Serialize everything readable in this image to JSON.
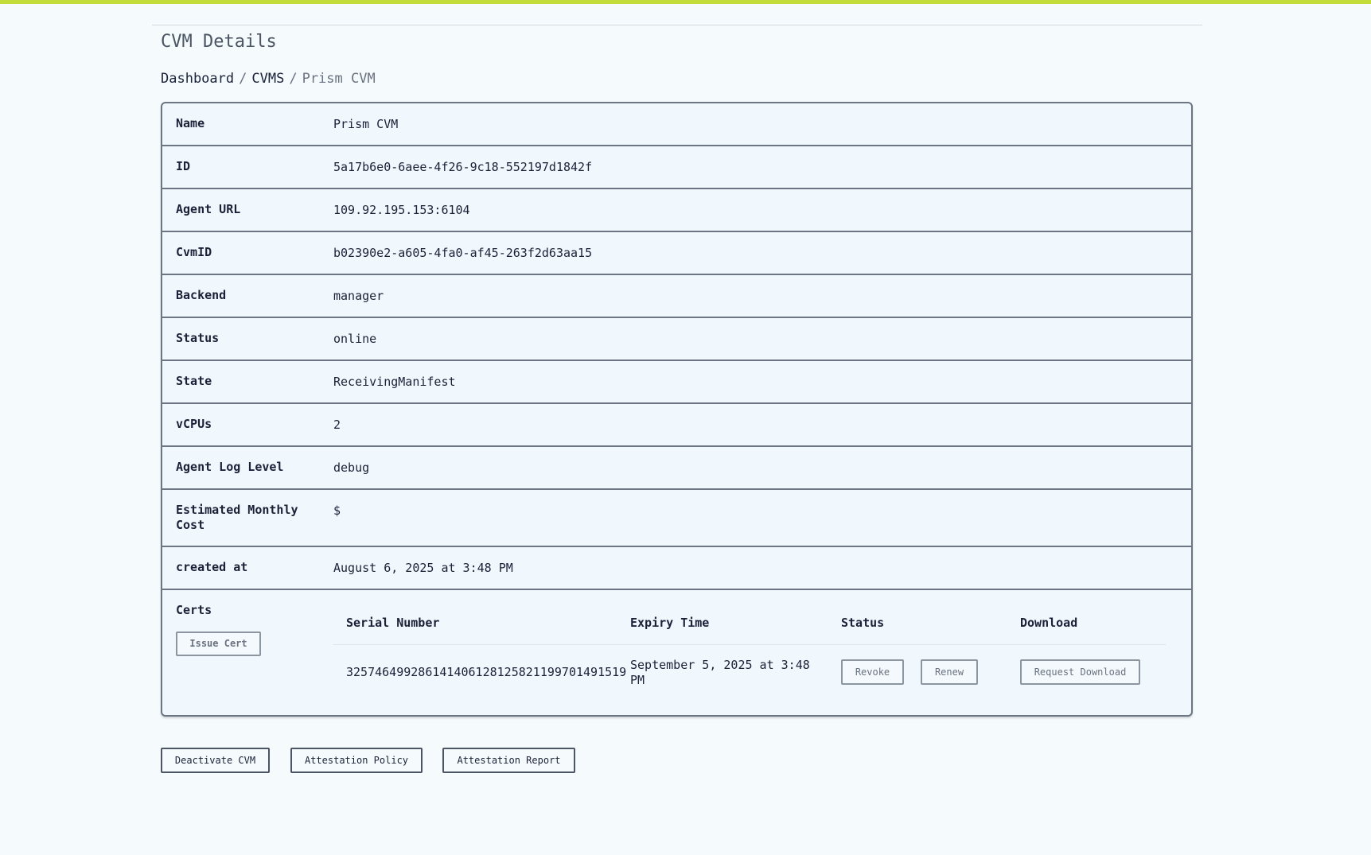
{
  "header": {
    "title": "CVM Details"
  },
  "breadcrumb": {
    "items": [
      "Dashboard",
      "CVMS"
    ],
    "current": "Prism CVM",
    "separator": "/"
  },
  "details": [
    {
      "label": "Name",
      "value": "Prism CVM"
    },
    {
      "label": "ID",
      "value": "5a17b6e0-6aee-4f26-9c18-552197d1842f"
    },
    {
      "label": "Agent URL",
      "value": "109.92.195.153:6104"
    },
    {
      "label": "CvmID",
      "value": "b02390e2-a605-4fa0-af45-263f2d63aa15"
    },
    {
      "label": "Backend",
      "value": "manager"
    },
    {
      "label": "Status",
      "value": "online"
    },
    {
      "label": "State",
      "value": "ReceivingManifest"
    },
    {
      "label": "vCPUs",
      "value": "2"
    },
    {
      "label": "Agent Log Level",
      "value": "debug"
    },
    {
      "label": "Estimated Monthly Cost",
      "value": "$"
    },
    {
      "label": "created at",
      "value": "August 6, 2025 at 3:48 PM"
    }
  ],
  "certs": {
    "label": "Certs",
    "issue_label": "Issue Cert",
    "columns": [
      "Serial Number",
      "Expiry Time",
      "Status",
      "Download"
    ],
    "rows": [
      {
        "serial": "325746499286141406128125821199701491519",
        "expiry": "September 5, 2025 at 3:48 PM",
        "revoke_label": "Revoke",
        "renew_label": "Renew",
        "download_label": "Request Download"
      }
    ]
  },
  "actions": {
    "deactivate": "Deactivate CVM",
    "policy": "Attestation Policy",
    "report": "Attestation Report"
  },
  "colors": {
    "accent_bar": "#c3dc3c",
    "background": "#f5fafd",
    "border": "#6b7682"
  }
}
